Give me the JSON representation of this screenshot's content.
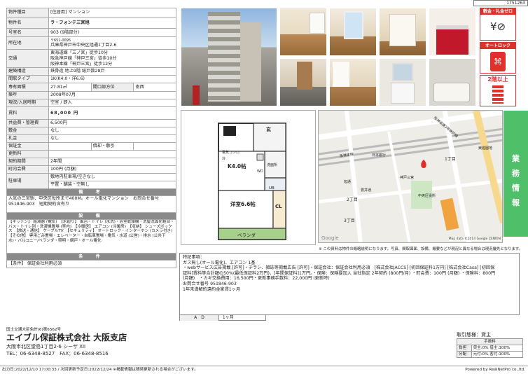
{
  "property_id": "1751263",
  "spec": {
    "type_label": "物件種目",
    "type_value": "[住居用] マンション",
    "name_label": "物件名",
    "name_value": "ラ・フォンテ三宮旭",
    "room_label": "号室名",
    "room_value": "903 (9階部分)",
    "addr_label": "所在地",
    "postal": "〒651-0095",
    "addr_value": "兵庫県神戸市中央区旭通1丁目2-6",
    "traffic_label": "交通",
    "traffic_1": "東海道線「三ノ宮」徒歩10分",
    "traffic_2": "阪急神戸線「神戸三宮」徒歩10分",
    "traffic_3": "阪神本線「神戸三宮」徒歩12分",
    "structure_label": "建築構造",
    "structure_value": "鉄骨造 地上9階 総戸数28戸",
    "layout_label": "間取タイプ",
    "layout_value": "1K(K4.0・洋6.6)",
    "area_label": "専有面積",
    "area_value": "27.81㎡",
    "window_label": "開口部方位",
    "window_value": "南西",
    "built_label": "築年",
    "built_value": "2008年07月",
    "status_label": "現況/入居時期",
    "status_value": "空室 / 即入",
    "rent_label": "賃料",
    "rent_value": "68,000 円",
    "fee_label": "共益費・管理費",
    "fee_value": "6,500円",
    "deposit_label": "敷金",
    "deposit_value": "なし",
    "keymoney_label": "礼金",
    "keymoney_value": "なし",
    "guarantee_label": "保証金",
    "guarantee_sub": "償却・敷引",
    "renewal_label": "更新料",
    "period_label": "契約期間",
    "period_value": "2年間",
    "cityfee_label": "町内会費",
    "cityfee_value": "100円 (月額)",
    "parking_label": "駐車場",
    "parking_1": "敷地内駐車場/空きなし",
    "parking_2": "平置・舗装・空無し"
  },
  "remarks_head": "備　考",
  "remarks_text": "人気の三宮駅、中央区役所まで400M。オール電化マンション　お問合せ番号 951846-903　短期契約含有り",
  "equip_head": "設　備",
  "equip_text": "【キッチン】 給湯器 (電気)　【水廻り】 風呂・トイレ (水洗)・浴室乾燥機・洗髪洗面化粧台・バス・トイレ別・洗濯機置場 (室内)　【冷暖房】 エアコン (冷暖房)　【収納】 シューズボックス　【放送・通信】 ケーブルTV　【セキュリティ】 オートロック・インターホン (カメラ付き)　【その他】 専用ごみ置場・エレベーター・自転車置場・電気・水道 (公営)・排水 (公共下水)・バルコニー/ベランダ・照明・網戸・オール電化",
  "cond_head": "条　件",
  "cond_text": "【条件】 保証会社利用必須",
  "badges": {
    "b1": "敷金・礼金ゼロ",
    "b2": "オートロック",
    "b3": "2階以上"
  },
  "floorplan": {
    "genkan": "玄",
    "k": "K4.0帖",
    "you": "洋室6.6帖",
    "cl": "CL",
    "ub": "UB",
    "veranda": "ベランダ",
    "sen": "洗面所",
    "reizo": "冷",
    "denki": "電気コンロ",
    "wd": "WD"
  },
  "map": {
    "credit": "Map data ©2014 Google ZENRIN",
    "google": "Google",
    "labels": [
      "1丁目",
      "2丁目",
      "3丁目",
      "日本銀行",
      "阪神本線",
      "阪神高速3号神戸線",
      "中央区役所",
      "東遊園地",
      "雲井通",
      "旭通",
      "神戸三宮"
    ]
  },
  "sidebar": [
    "業",
    "務",
    "情",
    "報"
  ],
  "map_note": "※ この資料は物件の概略説明になります。写真、間取図面、設備、概要などが現況と異なる場合は現況優先となります。",
  "remarks_lines": [
    "特記事項：",
    "ガス無し(オール電化)、エアコン 1基",
    "・webサービス広告掲載 [許可]・チラシ、雑誌等掲載広告 [許可]・保証会社：保証会社利用必須　[株式会社JACCS] [初回保証料1万円] [株式会社Casa] [初回保",
    "証料]賃料等合計額の50%(最低保証料2万円)、[年間保証料]1万円。・保険：保険要加入 当社指定 2年契約 (800円/月) ・町会費：100円 (月額) ・保険料：800円",
    "(月額)　・カギ交換費用：16,500円・更新事務手数料：22,000円 (更新時)",
    "お問合せ番号 951846-903",
    "1年未満解約違約金家賃1ヶ月"
  ],
  "ad": {
    "label": "A　D",
    "value": "1ヶ月"
  },
  "company": {
    "license": "国土交通大臣免許(6)第6562号",
    "name": "エイブル保証株式会社 大阪支店",
    "address": "大阪市北区堂島1丁目2-6 シーザ XII",
    "tel": "TEL：06-6348-8527　FAX：06-6348-8516"
  },
  "transaction": {
    "label": "取引態様：貸主",
    "fee_head": "手数料",
    "r1l": "負担",
    "r1v": "貸主:0%  借主:100%",
    "r2l": "分配",
    "r2v": "元付:0%  客付:100%"
  },
  "bottom": {
    "left": "出力日:2022/12/10 17:00:33 / 次回更新予定日:2022/12/24 ※掲載情報は随時更新される場合がございます。",
    "right": "Powered by RealNetPro co.,ltd."
  }
}
